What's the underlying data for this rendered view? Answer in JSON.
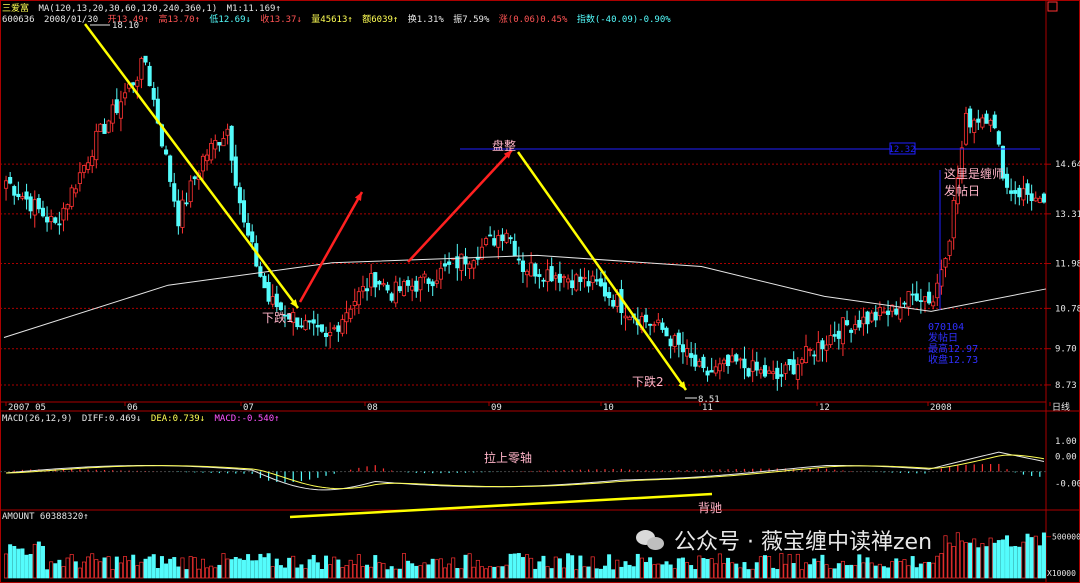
{
  "header": {
    "stock_name": "三爱富",
    "ma_settings": "MA(120,13,20,30,60,120,240,360,1)",
    "m1": "M1:11.169↑",
    "code": "600636",
    "date": "2008/01/30",
    "open": "开13.49↑",
    "high": "高13.70↑",
    "low": "低12.69↓",
    "close": "收13.37↓",
    "volume": "量45613↑",
    "amount": "额6039↑",
    "turnover": "换1.31%",
    "amplitude": "振7.59%",
    "change": "涨(0.06)0.45%",
    "index": "指数(-40.09)-0.90%"
  },
  "macd_header": {
    "title": "MACD(26,12,9)",
    "diff": "DIFF:0.469↓",
    "dea": "DEA:0.739↓",
    "macd": "MACD:-0.540↑"
  },
  "amount_header": {
    "title": "AMOUNT 60388320↑"
  },
  "watermark": {
    "text": "公众号 · 薇宝缠中读禅zen"
  },
  "colors": {
    "up": "#ff3232",
    "down": "#54fcfc",
    "ma": "#e6e6e6",
    "arrow_yellow": "#ffff00",
    "arrow_red": "#ff2020",
    "annotation": "#ffb4c8",
    "axis": "#aa0000"
  },
  "chart_data": {
    "type": "candlestick",
    "price_ticks": [
      14.64,
      13.31,
      11.98,
      10.78,
      9.7,
      8.73
    ],
    "x_labels": [
      "2007 05",
      "06",
      "07",
      "08",
      "09",
      "10",
      "11",
      "12",
      "2008",
      "日线"
    ],
    "high_label": "18.10",
    "low_label": "8.51",
    "box_label": "12.32",
    "info_box": [
      "070104",
      "发帖日",
      "最高12.97",
      "收盘12.73"
    ],
    "annotations": [
      "下跌1",
      "盘整",
      "下跌2",
      "这里是缠师\n发帖日",
      "拉上零轴",
      "背驰"
    ],
    "macd_ticks": [
      "1.00",
      "0.00",
      "-0.00"
    ],
    "volume_ticks": [
      "500000",
      "X10000"
    ],
    "price_range": [
      8.3,
      18.5
    ],
    "macd_range": [
      -1.2,
      1.7
    ],
    "volume_range": [
      0,
      750000
    ],
    "volume_unit": "X10000"
  }
}
